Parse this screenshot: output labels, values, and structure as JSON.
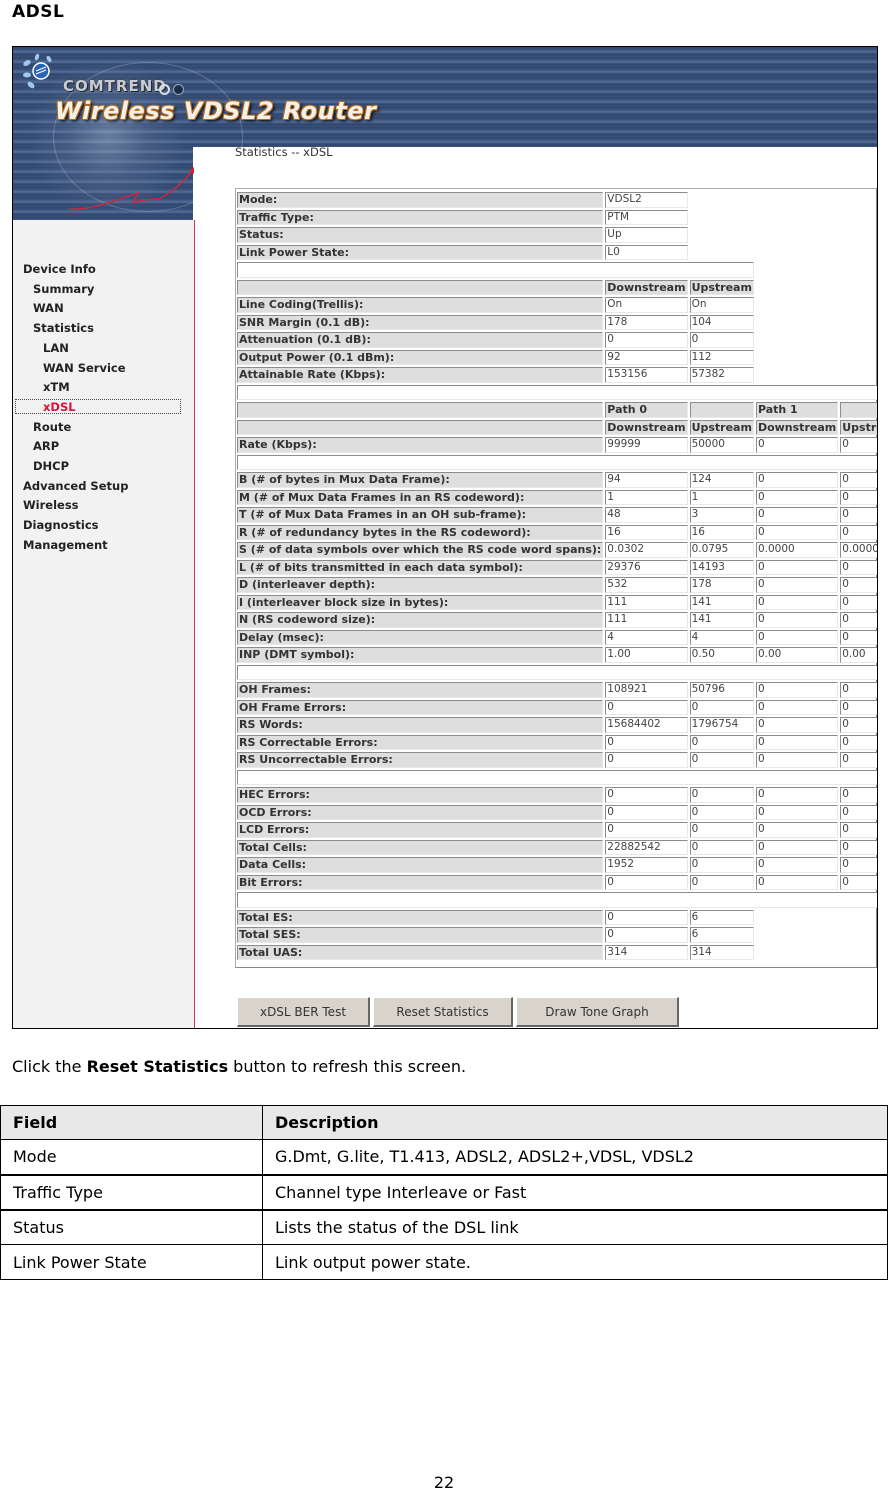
{
  "document": {
    "heading": "ADSL",
    "caption_prefix": "Click the ",
    "caption_bold": "Reset Statistics",
    "caption_suffix": " button to refresh this screen.",
    "page_number": "22"
  },
  "router_ui": {
    "brand": "COMTREND",
    "product": "Wireless VDSL2 Router",
    "page_title": "Statistics -- xDSL",
    "colors": {
      "banner": "#3a5279",
      "sidebar_bg": "#f2f2f2",
      "active_nav": "#e0103c",
      "label_bg": "#dedede",
      "button_bg": "#d8d4cc"
    },
    "sidebar": {
      "items": [
        {
          "label": "Device Info",
          "level": 0
        },
        {
          "label": "Summary",
          "level": 1
        },
        {
          "label": "WAN",
          "level": 1
        },
        {
          "label": "Statistics",
          "level": 1
        },
        {
          "label": "LAN",
          "level": 2
        },
        {
          "label": "WAN Service",
          "level": 2
        },
        {
          "label": "xTM",
          "level": 2
        },
        {
          "label": "xDSL",
          "level": 2,
          "active": true
        },
        {
          "label": "Route",
          "level": 1
        },
        {
          "label": "ARP",
          "level": 1
        },
        {
          "label": "DHCP",
          "level": 1
        },
        {
          "label": "Advanced Setup",
          "level": 0
        },
        {
          "label": "Wireless",
          "level": 0
        },
        {
          "label": "Diagnostics",
          "level": 0
        },
        {
          "label": "Management",
          "level": 0
        }
      ]
    },
    "status": {
      "rows": [
        {
          "label": "Mode:",
          "value": "VDSL2"
        },
        {
          "label": "Traffic Type:",
          "value": "PTM"
        },
        {
          "label": "Status:",
          "value": "Up"
        },
        {
          "label": "Link Power State:",
          "value": "L0"
        }
      ]
    },
    "line": {
      "headers": [
        "Downstream",
        "Upstream"
      ],
      "rows": [
        {
          "label": "Line Coding(Trellis):",
          "values": [
            "On",
            "On"
          ]
        },
        {
          "label": "SNR Margin (0.1 dB):",
          "values": [
            "178",
            "104"
          ]
        },
        {
          "label": "Attenuation (0.1 dB):",
          "values": [
            "0",
            "0"
          ]
        },
        {
          "label": "Output Power (0.1 dBm):",
          "values": [
            "92",
            "112"
          ]
        },
        {
          "label": "Attainable Rate (Kbps):",
          "values": [
            "153156",
            "57382"
          ]
        }
      ]
    },
    "paths": {
      "path_headers": [
        "Path 0",
        "",
        "Path 1",
        ""
      ],
      "dir_headers": [
        "Downstream",
        "Upstream",
        "Downstream",
        "Upstream"
      ],
      "rate": {
        "label": "Rate (Kbps):",
        "values": [
          "99999",
          "50000",
          "0",
          "0"
        ]
      },
      "framing": [
        {
          "label": "B (# of bytes in Mux Data Frame):",
          "values": [
            "94",
            "124",
            "0",
            "0"
          ]
        },
        {
          "label": "M (# of Mux Data Frames in an RS codeword):",
          "values": [
            "1",
            "1",
            "0",
            "0"
          ]
        },
        {
          "label": "T (# of Mux Data Frames in an OH sub-frame):",
          "values": [
            "48",
            "3",
            "0",
            "0"
          ]
        },
        {
          "label": "R (# of redundancy bytes in the RS codeword):",
          "values": [
            "16",
            "16",
            "0",
            "0"
          ]
        },
        {
          "label": "S (# of data symbols over which the RS code word spans):",
          "values": [
            "0.0302",
            "0.0795",
            "0.0000",
            "0.0000"
          ]
        },
        {
          "label": "L (# of bits transmitted in each data symbol):",
          "values": [
            "29376",
            "14193",
            "0",
            "0"
          ]
        },
        {
          "label": "D (interleaver depth):",
          "values": [
            "532",
            "178",
            "0",
            "0"
          ]
        },
        {
          "label": "I (interleaver block size in bytes):",
          "values": [
            "111",
            "141",
            "0",
            "0"
          ]
        },
        {
          "label": "N (RS codeword size):",
          "values": [
            "111",
            "141",
            "0",
            "0"
          ]
        },
        {
          "label": "Delay (msec):",
          "values": [
            "4",
            "4",
            "0",
            "0"
          ]
        },
        {
          "label": "INP (DMT symbol):",
          "values": [
            "1.00",
            "0.50",
            "0.00",
            "0.00"
          ]
        }
      ],
      "frames": [
        {
          "label": "OH Frames:",
          "values": [
            "108921",
            "50796",
            "0",
            "0"
          ]
        },
        {
          "label": "OH Frame Errors:",
          "values": [
            "0",
            "0",
            "0",
            "0"
          ]
        },
        {
          "label": "RS Words:",
          "values": [
            "15684402",
            "1796754",
            "0",
            "0"
          ]
        },
        {
          "label": "RS Correctable Errors:",
          "values": [
            "0",
            "0",
            "0",
            "0"
          ]
        },
        {
          "label": "RS Uncorrectable Errors:",
          "values": [
            "0",
            "0",
            "0",
            "0"
          ]
        }
      ],
      "cells": [
        {
          "label": "HEC Errors:",
          "values": [
            "0",
            "0",
            "0",
            "0"
          ]
        },
        {
          "label": "OCD Errors:",
          "values": [
            "0",
            "0",
            "0",
            "0"
          ]
        },
        {
          "label": "LCD Errors:",
          "values": [
            "0",
            "0",
            "0",
            "0"
          ]
        },
        {
          "label": "Total Cells:",
          "values": [
            "22882542",
            "0",
            "0",
            "0"
          ]
        },
        {
          "label": "Data Cells:",
          "values": [
            "1952",
            "0",
            "0",
            "0"
          ]
        },
        {
          "label": "Bit Errors:",
          "values": [
            "0",
            "0",
            "0",
            "0"
          ]
        }
      ]
    },
    "totals": [
      {
        "label": "Total ES:",
        "values": [
          "0",
          "6"
        ]
      },
      {
        "label": "Total SES:",
        "values": [
          "0",
          "6"
        ]
      },
      {
        "label": "Total UAS:",
        "values": [
          "314",
          "314"
        ]
      }
    ],
    "buttons": {
      "ber_test": "xDSL BER Test",
      "reset": "Reset Statistics",
      "tone_graph": "Draw Tone Graph"
    }
  },
  "field_table": {
    "headers": [
      "Field",
      "Description"
    ],
    "rows": [
      {
        "field": "Mode",
        "description": "G.Dmt, G.lite, T1.413, ADSL2, ADSL2+,VDSL, VDSL2"
      },
      {
        "field": "Traffic Type",
        "description": "Channel type Interleave or Fast"
      },
      {
        "field": "Status",
        "description": "Lists the status of the DSL link"
      },
      {
        "field": "Link Power State",
        "description": "Link output power state."
      }
    ]
  }
}
